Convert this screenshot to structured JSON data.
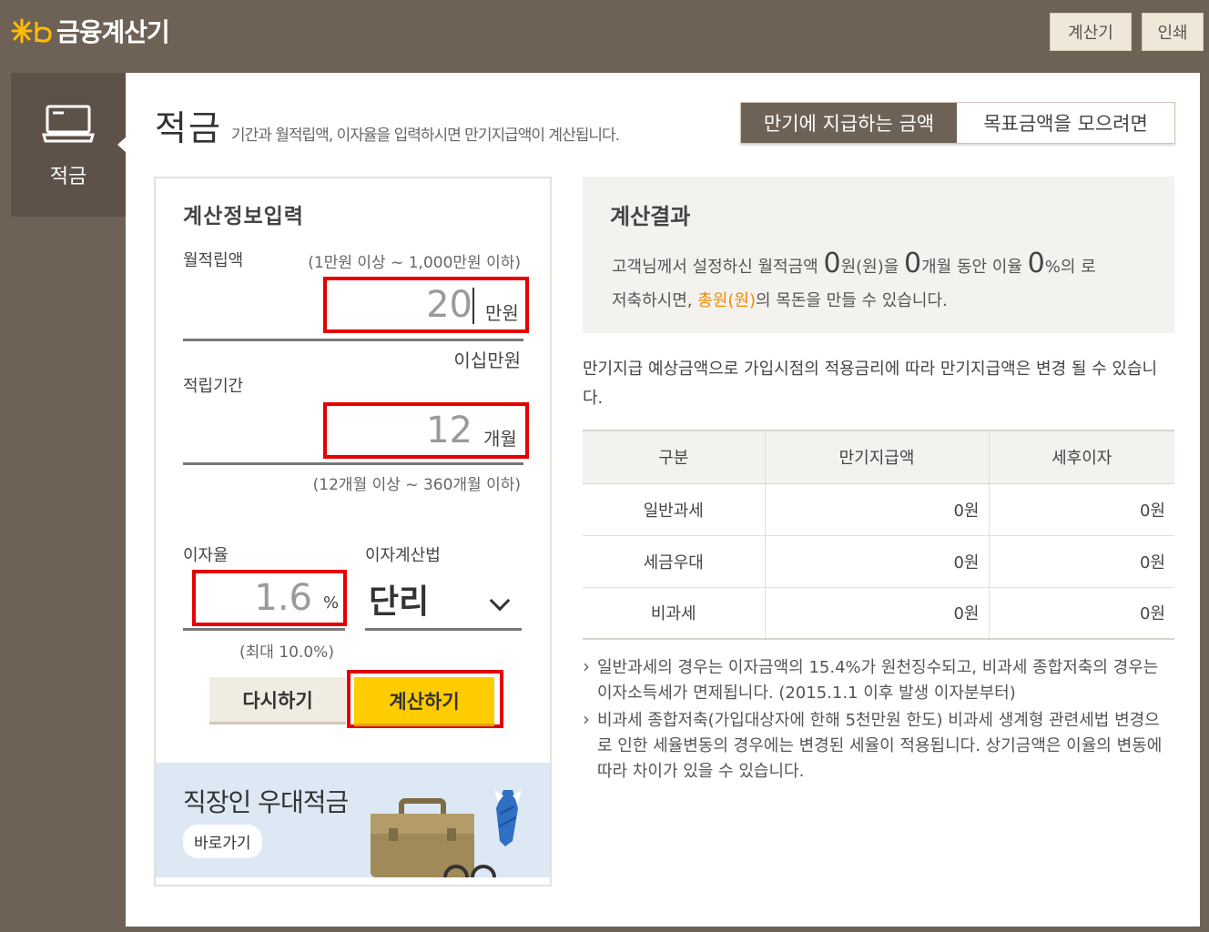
{
  "header": {
    "logo_text": "금융계산기",
    "calc_button": "계산기",
    "print_button": "인쇄"
  },
  "sidebar": {
    "label": "적금",
    "icon": "laptop-icon"
  },
  "page": {
    "title": "적금",
    "description": "기간과 월적립액, 이자율을 입력하시면 만기지급액이 계산됩니다."
  },
  "mode_tabs": [
    {
      "label": "만기에 지급하는 금액",
      "active": true
    },
    {
      "label": "목표금액을 모으려면",
      "active": false
    }
  ],
  "input": {
    "title": "계산정보입력",
    "monthly": {
      "label": "월적립액",
      "range": "(1만원 이상 ~ 1,000만원 이하)",
      "value": "20",
      "unit": "만원",
      "korean": "이십만원"
    },
    "period": {
      "label": "적립기간",
      "value": "12",
      "unit": "개월",
      "range": "(12개월 이상 ~ 360개월 이하)"
    },
    "rate": {
      "label": "이자율",
      "value": "1.6",
      "unit": "%",
      "max": "(최대 10.0%)"
    },
    "method": {
      "label": "이자계산법",
      "value": "단리"
    },
    "reset_button": "다시하기",
    "submit_button": "계산하기"
  },
  "banner": {
    "title": "직장인 우대적금",
    "link": "바로가기"
  },
  "result": {
    "title": "계산결과",
    "line1_a": "고객님께서 설정하신 월적금액",
    "amount": "0",
    "line1_b": "원(원)을",
    "months": "0",
    "line1_c": "개월 동안 이율",
    "rate": "0",
    "line1_d": "%의 로",
    "line2_a": "저축하시면,",
    "total": "총원(원)",
    "line2_b": "의 목돈을 만들 수 있습니다."
  },
  "notice": "만기지급 예상금액으로 가입시점의 적용금리에 따라 만기지급액은 변경 될 수 있습니다.",
  "table": {
    "headers": [
      "구분",
      "만기지급액",
      "세후이자"
    ],
    "rows": [
      [
        "일반과세",
        "0원",
        "0원"
      ],
      [
        "세금우대",
        "0원",
        "0원"
      ],
      [
        "비과세",
        "0원",
        "0원"
      ]
    ]
  },
  "footnotes": [
    "일반과세의 경우는 이자금액의 15.4%가 원천징수되고, 비과세 종합저축의 경우는 이자소득세가 면제됩니다. (2015.1.1 이후 발생 이자분부터)",
    "비과세 종합저축(가입대상자에 한해 5천만원 한도) 비과세 생계형 관련세법 변경으로 인한 세율변동의 경우에는 변경된 세율이 적용됩니다. 상기금액은 이율의 변동에 따라 차이가 있을 수 있습니다."
  ],
  "colors": {
    "frame": "#6e6257",
    "accent_button": "#ffcc00",
    "highlight": "#e60000",
    "orange_text": "#f28a00"
  }
}
